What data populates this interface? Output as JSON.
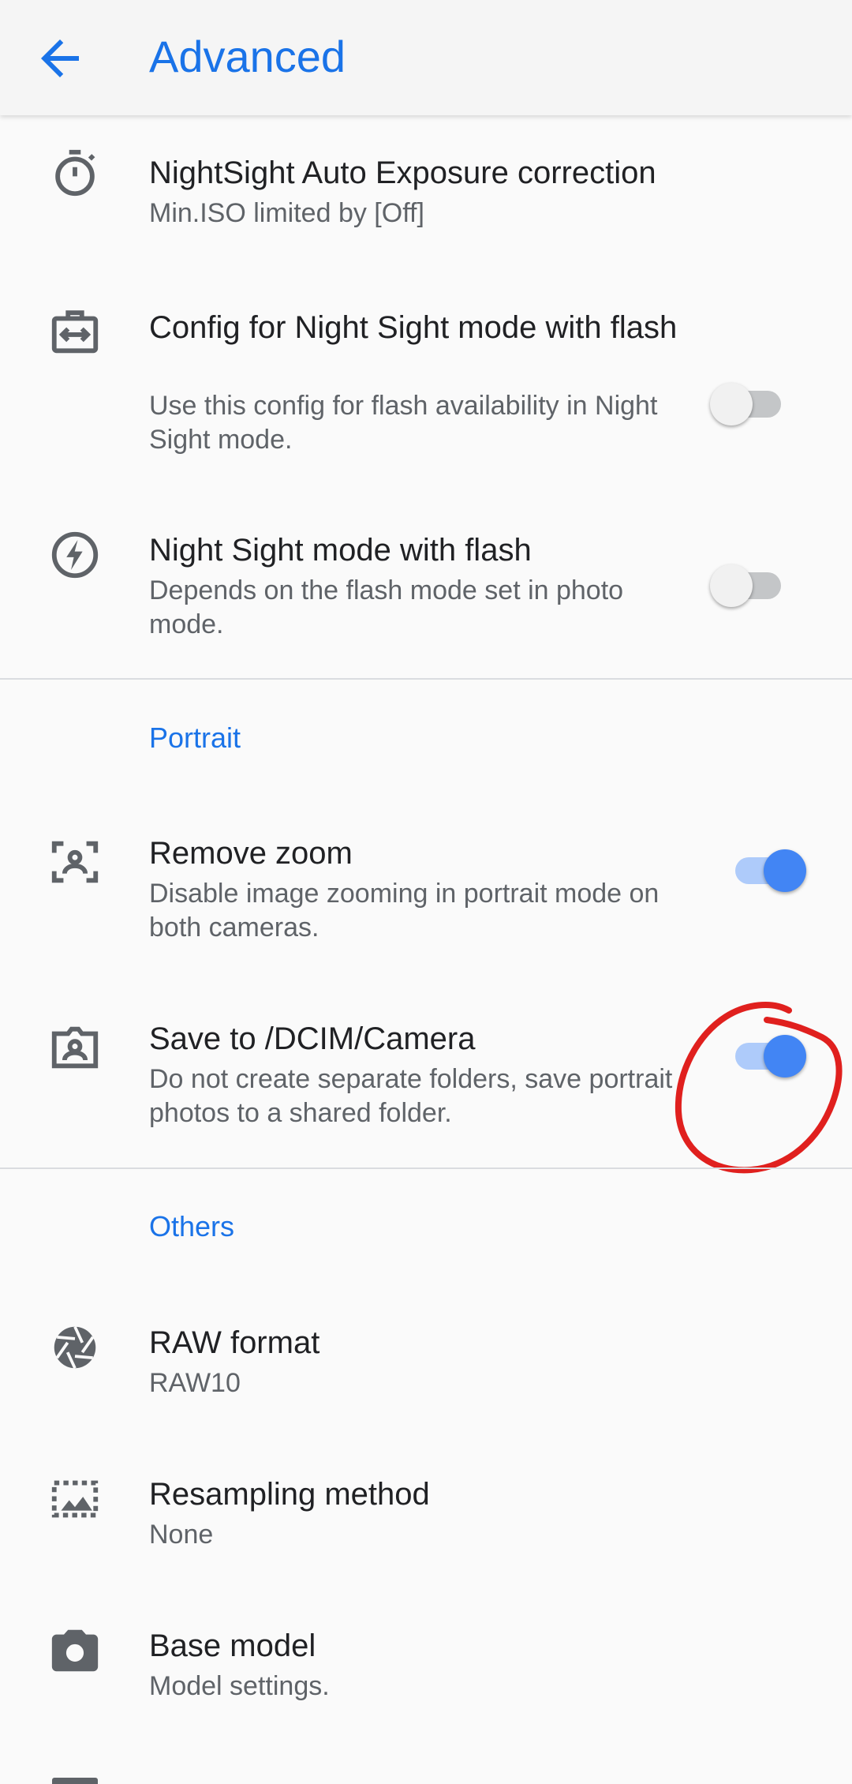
{
  "header": {
    "title": "Advanced",
    "accent_color": "#1a73e8"
  },
  "items": [
    {
      "icon": "timer-icon",
      "title": "NightSight Auto Exposure correction",
      "subtitle": "Min.ISO limited by [Off]"
    },
    {
      "icon": "flash-config-icon",
      "title": "Config for Night Sight mode with flash",
      "subtitle": "Use this config for flash availability in Night Sight mode.",
      "toggle": false
    },
    {
      "icon": "flash-circle-icon",
      "title": "Night Sight mode with flash",
      "subtitle": "Depends on the flash mode set in photo mode.",
      "toggle": false
    }
  ],
  "portrait": {
    "header": "Portrait",
    "items": [
      {
        "icon": "face-frame-icon",
        "title": "Remove zoom",
        "subtitle": "Disable image zooming in portrait mode on both cameras.",
        "toggle": true
      },
      {
        "icon": "portrait-folder-icon",
        "title": "Save to /DCIM/Camera",
        "subtitle": "Do not create separate folders, save portrait photos to a shared folder.",
        "toggle": true
      }
    ]
  },
  "others": {
    "header": "Others",
    "items": [
      {
        "icon": "aperture-icon",
        "title": "RAW format",
        "subtitle": "RAW10"
      },
      {
        "icon": "image-resample-icon",
        "title": "Resampling method",
        "subtitle": "None"
      },
      {
        "icon": "camera-icon",
        "title": "Base model",
        "subtitle": "Model settings."
      }
    ]
  },
  "annotation_color": "#e0201e"
}
